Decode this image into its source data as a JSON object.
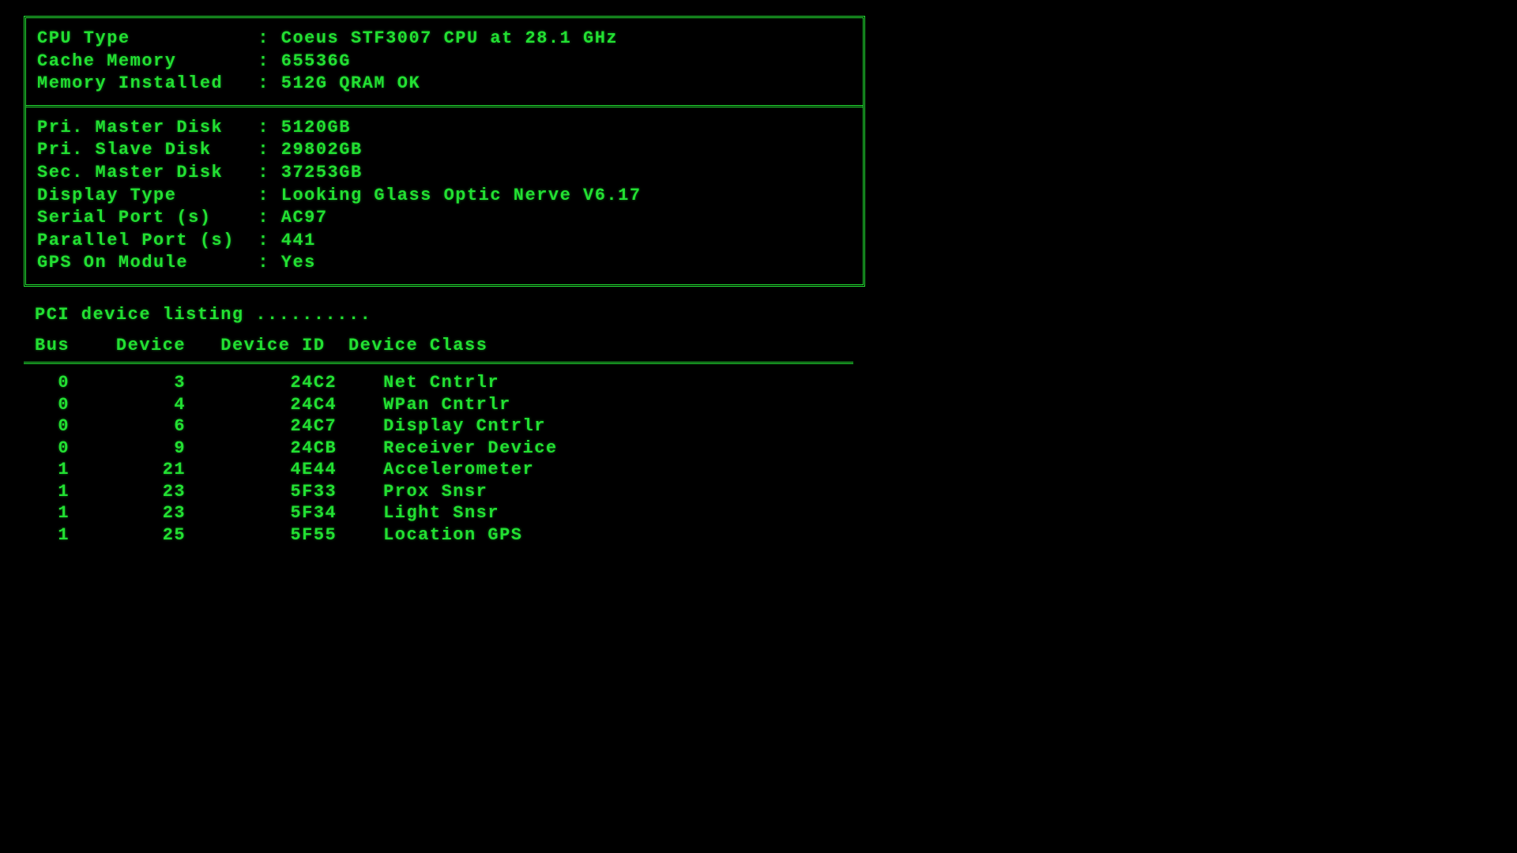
{
  "sysinfo": {
    "cpu_label": "CPU Type",
    "cpu_value": "Coeus STF3007 CPU at 28.1 GHz",
    "cache_label": "Cache Memory",
    "cache_value": "65536G",
    "mem_label": "Memory Installed",
    "mem_value": "512G QRAM OK"
  },
  "disks": {
    "pri_master_label": "Pri. Master Disk",
    "pri_master_value": "5120GB",
    "pri_slave_label": "Pri. Slave Disk",
    "pri_slave_value": "29802GB",
    "sec_master_label": "Sec. Master Disk",
    "sec_master_value": "37253GB",
    "display_label": "Display Type",
    "display_value": "Looking Glass Optic Nerve V6.17",
    "serial_label": "Serial Port (s)",
    "serial_value": "AC97",
    "parallel_label": "Parallel Port (s)",
    "parallel_value": "441",
    "gps_label": "GPS On Module",
    "gps_value": "Yes"
  },
  "pci": {
    "heading": "PCI device listing ..........",
    "col_bus": "Bus",
    "col_device": "Device",
    "col_device_id": "Device ID",
    "col_device_class": "Device Class",
    "rows": [
      {
        "bus": "0",
        "device": "3",
        "id": "24C2",
        "class": "Net Cntrlr"
      },
      {
        "bus": "0",
        "device": "4",
        "id": "24C4",
        "class": "WPan Cntrlr"
      },
      {
        "bus": "0",
        "device": "6",
        "id": "24C7",
        "class": "Display Cntrlr"
      },
      {
        "bus": "0",
        "device": "9",
        "id": "24CB",
        "class": "Receiver Device"
      },
      {
        "bus": "1",
        "device": "21",
        "id": "4E44",
        "class": "Accelerometer"
      },
      {
        "bus": "1",
        "device": "23",
        "id": "5F33",
        "class": "Prox Snsr"
      },
      {
        "bus": "1",
        "device": "23",
        "id": "5F34",
        "class": "Light Snsr"
      },
      {
        "bus": "1",
        "device": "25",
        "id": "5F55",
        "class": "Location GPS"
      }
    ]
  }
}
